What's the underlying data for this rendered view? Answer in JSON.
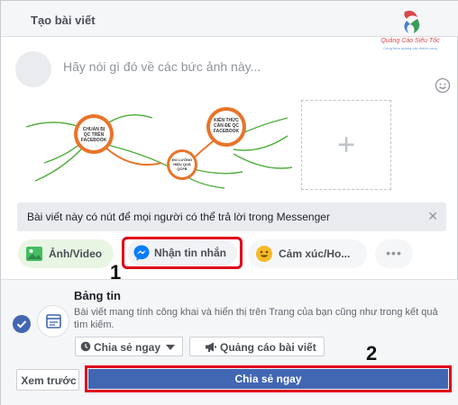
{
  "header": {
    "title": "Tạo bài viết"
  },
  "logo": {
    "name": "Quảng Cáo Siêu Tốc",
    "tagline": "Công thức quảng cáo thành công"
  },
  "composer": {
    "placeholder": "Hãy nói gì đó về các bức ảnh này..."
  },
  "media": {
    "labels": [
      "CHUẨN BỊ QC TRÊN FACEBOOK",
      "ĐO LƯỜNG HIỆU QUẢ QCFB",
      "KIẾN THỨC CẦN ĐỂ QC FACEBOOK"
    ]
  },
  "messenger_notice": {
    "text": "Bài viết này có nút để mọi người có thể trả lời trong Messenger"
  },
  "actions": {
    "photo_video": "Ảnh/Video",
    "get_messages": "Nhận tin nhắn",
    "feeling": "Cảm xúc/Ho...",
    "more": "•••"
  },
  "steps": {
    "one": "1",
    "two": "2"
  },
  "news_feed": {
    "title": "Bảng tin",
    "description": "Bài viết mang tính công khai và hiển thị trên Trang của bạn cũng như trong kết quả tìm kiếm.",
    "share_option": "Chia sẻ ngay",
    "ads_option": "Quảng cáo bài viết"
  },
  "footer": {
    "preview": "Xem trước",
    "share_now": "Chia sẻ ngay"
  },
  "colors": {
    "fb_blue": "#4267b2",
    "highlight_red": "#e0001a",
    "orange": "#e8742a"
  }
}
